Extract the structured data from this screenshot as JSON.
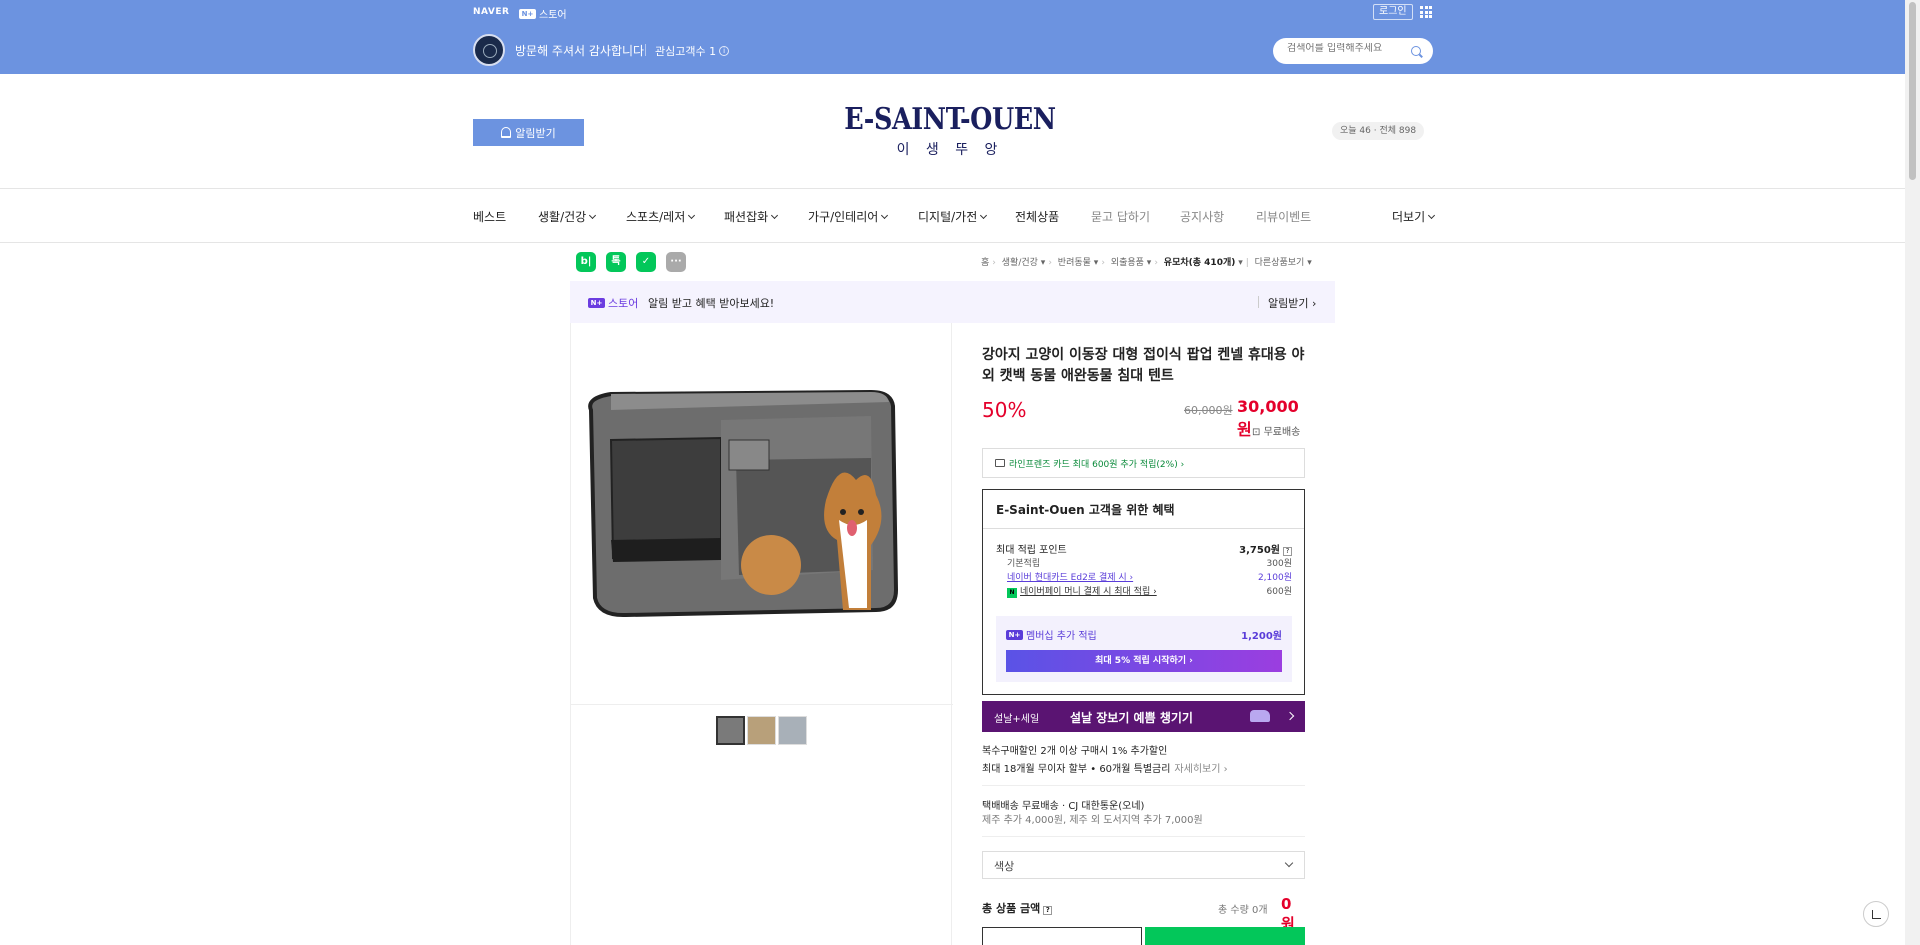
{
  "top": {
    "naver": "NAVER",
    "store": "스토어",
    "np_badge": "N+",
    "login": "로그인"
  },
  "store_header": {
    "welcome": "방문해 주셔서 감사합니다",
    "fav": "관심고객수 1",
    "search_placeholder": "검색어를 입력해주세요"
  },
  "brand": {
    "alarm_button": "알림받기",
    "name": "E-SAINT-OUEN",
    "subtitle": "이 생 뚜 앙",
    "visitors": "오늘 46 · 전체 898"
  },
  "nav": {
    "items": [
      "베스트",
      "생활/건강",
      "스포츠/레저",
      "패션잡화",
      "가구/인테리어",
      "디지털/가전",
      "전체상품",
      "묻고 답하기",
      "공지사항",
      "리뷰이벤트"
    ],
    "more": "더보기"
  },
  "social": {
    "blog": "b|",
    "talk": "톡",
    "bookmark": "✓",
    "more": "···"
  },
  "breadcrumb": {
    "items": [
      "홈",
      "생활/건강",
      "반려동물",
      "외출용품",
      "유모차(총 410개)",
      "다른상품보기"
    ]
  },
  "store_banner": {
    "logo": "스토어",
    "text": "알림 받고 혜택 받아보세요!",
    "alarm": "알림받기 ›"
  },
  "product": {
    "title": "강아지 고양이 이동장 대형 접이식 팝업 켄넬 휴대용 야외 캣백 동물 애완동물 침대 텐트",
    "discount": "50%",
    "original_price": "60,000원",
    "price": "30,000원",
    "shipping_short": "무료배송",
    "card_benefit": "라인프렌즈 카드 최대 600원 추가 적립(2%) ›"
  },
  "benefit": {
    "title": "E-Saint-Ouen 고객을 위한 혜택",
    "max_points_label": "최대 적립 포인트",
    "max_points": "3,750원",
    "rows": [
      {
        "label": "기본적립",
        "value": "300원"
      },
      {
        "label": "네이버 현대카드 Ed2로 결제 시 ›",
        "value": "2,100원"
      },
      {
        "label": "네이버페이 머니 결제 시 최대 적립 ›",
        "value": "600원"
      }
    ],
    "membership_label": "멤버십 추가 적립",
    "membership_value": "1,200원",
    "membership_button": "최대 5% 적립 시작하기 ›"
  },
  "sale_banner": {
    "label": "설날+세일",
    "text": "설날 장보기 예쁨 챙기기"
  },
  "discounts": {
    "multi": "복수구매할인   2개 이상 구매시 1% 추가할인",
    "installment": "최대 18개월 무이자 할부 • 60개월 특별금리",
    "installment_more": "자세히보기 ›"
  },
  "delivery": {
    "line1": "택배배송   무료배송 · CJ 대한통운(오네)",
    "line2": "제주 추가 4,000원, 제주 외 도서지역 추가 7,000원"
  },
  "options": {
    "color": "색상"
  },
  "total": {
    "label": "총 상품 금액",
    "qty": "총 수량 0개",
    "value": "0원"
  }
}
